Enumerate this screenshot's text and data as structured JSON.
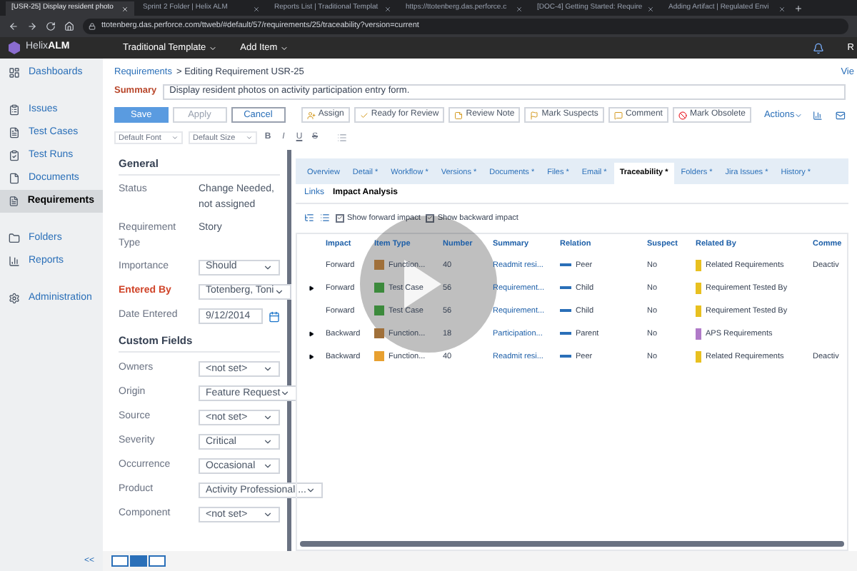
{
  "browser": {
    "tabs": [
      {
        "title": "[USR-25] Display resident photo",
        "selected": true
      },
      {
        "title": "Sprint 2 Folder | Helix ALM",
        "selected": false
      },
      {
        "title": "Reports List | Traditional Templat",
        "selected": false
      },
      {
        "title": "https://ttotenberg.das.perforce.c",
        "selected": false
      },
      {
        "title": "[DOC-4] Getting Started: Require",
        "selected": false
      },
      {
        "title": "Adding Artifact | Regulated Envi",
        "selected": false
      }
    ],
    "url": "ttotenberg.das.perforce.com/ttweb/#default/57/requirements/25/traceability?version=current"
  },
  "header": {
    "logo": [
      "Helix",
      "ALM"
    ],
    "menus": [
      "Traditional Template",
      "Add Item"
    ],
    "user": "R"
  },
  "sidebar": {
    "groups": [
      [
        {
          "label": "Dashboards",
          "selected": false
        }
      ],
      [
        {
          "label": "Issues",
          "selected": false
        },
        {
          "label": "Test Cases",
          "selected": false
        },
        {
          "label": "Test Runs",
          "selected": false
        },
        {
          "label": "Documents",
          "selected": false
        },
        {
          "label": "Requirements",
          "selected": true
        }
      ],
      [
        {
          "label": "Folders",
          "selected": false
        },
        {
          "label": "Reports",
          "selected": false
        }
      ],
      [
        {
          "label": "Administration",
          "selected": false
        }
      ]
    ],
    "collapse": "<<"
  },
  "breadcrumb": {
    "link": "Requirements",
    "rest": "> Editing Requirement USR-25",
    "view": "Vie"
  },
  "summary": {
    "label": "Summary",
    "value": "Display resident photos on activity participation entry form."
  },
  "edit_buttons": [
    {
      "label": "Save",
      "kind": "primary",
      "disabled": false
    },
    {
      "label": "Apply",
      "kind": "plain",
      "disabled": true
    },
    {
      "label": "Cancel",
      "kind": "plain",
      "disabled": false
    }
  ],
  "actions": [
    "Assign",
    "Ready for Review",
    "Review Note",
    "Mark Suspects",
    "Comment",
    "Mark Obsolete"
  ],
  "actions_menu": "Actions",
  "format": {
    "font": "Default Font",
    "size": "Default Size",
    "styles": [
      "B",
      "I",
      "U",
      "S"
    ]
  },
  "general": {
    "title": "General",
    "fields": [
      {
        "label": "Status",
        "value": "Change Needed, not assigned",
        "kind": "text",
        "required": false
      },
      {
        "label": "Requirement Type",
        "value": "Story",
        "kind": "text",
        "required": false
      },
      {
        "label": "Importance",
        "value": "Should",
        "kind": "select",
        "required": false
      },
      {
        "label": "Entered By",
        "value": "Totenberg, Toni",
        "kind": "select",
        "required": true
      },
      {
        "label": "Date Entered",
        "value": "9/12/2014",
        "kind": "date",
        "required": false
      }
    ]
  },
  "custom_fields": {
    "title": "Custom Fields",
    "fields": [
      {
        "label": "Owners",
        "value": "<not set>",
        "kind": "select",
        "required": false
      },
      {
        "label": "Origin",
        "value": "Feature Request",
        "kind": "select",
        "required": false
      },
      {
        "label": "Source",
        "value": "<not set>",
        "kind": "select",
        "required": false
      },
      {
        "label": "Severity",
        "value": "Critical",
        "kind": "select",
        "required": false
      },
      {
        "label": "Occurrence",
        "value": "Occasional",
        "kind": "select",
        "required": false
      },
      {
        "label": "Product",
        "value": "Activity Professional ...",
        "kind": "select",
        "required": false
      },
      {
        "label": "Component",
        "value": "<not set>",
        "kind": "select",
        "required": false
      }
    ]
  },
  "detail_tabs": [
    {
      "label": "Overview",
      "selected": false
    },
    {
      "label": "Detail *",
      "selected": false
    },
    {
      "label": "Workflow *",
      "selected": false
    },
    {
      "label": "Versions *",
      "selected": false
    },
    {
      "label": "Documents *",
      "selected": false
    },
    {
      "label": "Files *",
      "selected": false
    },
    {
      "label": "Email *",
      "selected": false
    },
    {
      "label": "Traceability *",
      "selected": true
    },
    {
      "label": "Folders *",
      "selected": false
    },
    {
      "label": "Jira Issues *",
      "selected": false
    },
    {
      "label": "History *",
      "selected": false
    }
  ],
  "sub_tabs": [
    {
      "label": "Links",
      "selected": false
    },
    {
      "label": "Impact Analysis",
      "selected": true
    }
  ],
  "impact_options": [
    {
      "label": "Show forward impact",
      "checked": true
    },
    {
      "label": "Show backward impact",
      "checked": true
    }
  ],
  "table": {
    "columns": [
      "Impact",
      "Item Type",
      "Number",
      "Summary",
      "Relation",
      "Suspect",
      "Related By",
      "Comme"
    ],
    "rows": [
      {
        "expandable": false,
        "impact": "Forward",
        "item_type": {
          "label": "Function...",
          "color": "#a0703a"
        },
        "number": "40",
        "summary": "Readmit resi...",
        "relation": "Peer",
        "suspect": "No",
        "related_by": {
          "label": "Related Requirements",
          "color": "#e8c020"
        },
        "comment": "Deactiv"
      },
      {
        "expandable": true,
        "impact": "Forward",
        "item_type": {
          "label": "Test Case",
          "color": "#3c8a3c"
        },
        "number": "56",
        "summary": "Requirement...",
        "relation": "Child",
        "suspect": "No",
        "related_by": {
          "label": "Requirement Tested By",
          "color": "#e8c020"
        }
      },
      {
        "expandable": false,
        "impact": "Forward",
        "item_type": {
          "label": "Test Case",
          "color": "#3c8a3c"
        },
        "number": "56",
        "summary": "Requirement...",
        "relation": "Child",
        "suspect": "No",
        "related_by": {
          "label": "Requirement Tested By",
          "color": "#e8c020"
        }
      },
      {
        "expandable": true,
        "impact": "Backward",
        "item_type": {
          "label": "Function...",
          "color": "#a0703a"
        },
        "number": "18",
        "summary": "Participation...",
        "relation": "Parent",
        "suspect": "No",
        "related_by": {
          "label": "APS Requirements",
          "color": "#b07ac8"
        }
      },
      {
        "expandable": true,
        "impact": "Backward",
        "item_type": {
          "label": "Function...",
          "color": "#e8a030"
        },
        "number": "40",
        "summary": "Readmit resi...",
        "relation": "Peer",
        "suspect": "No",
        "related_by": {
          "label": "Related Requirements",
          "color": "#e8c020"
        },
        "comment": "Deactiv"
      }
    ]
  },
  "view_buttons": [
    {
      "selected": false
    },
    {
      "selected": true
    },
    {
      "selected": false
    }
  ]
}
